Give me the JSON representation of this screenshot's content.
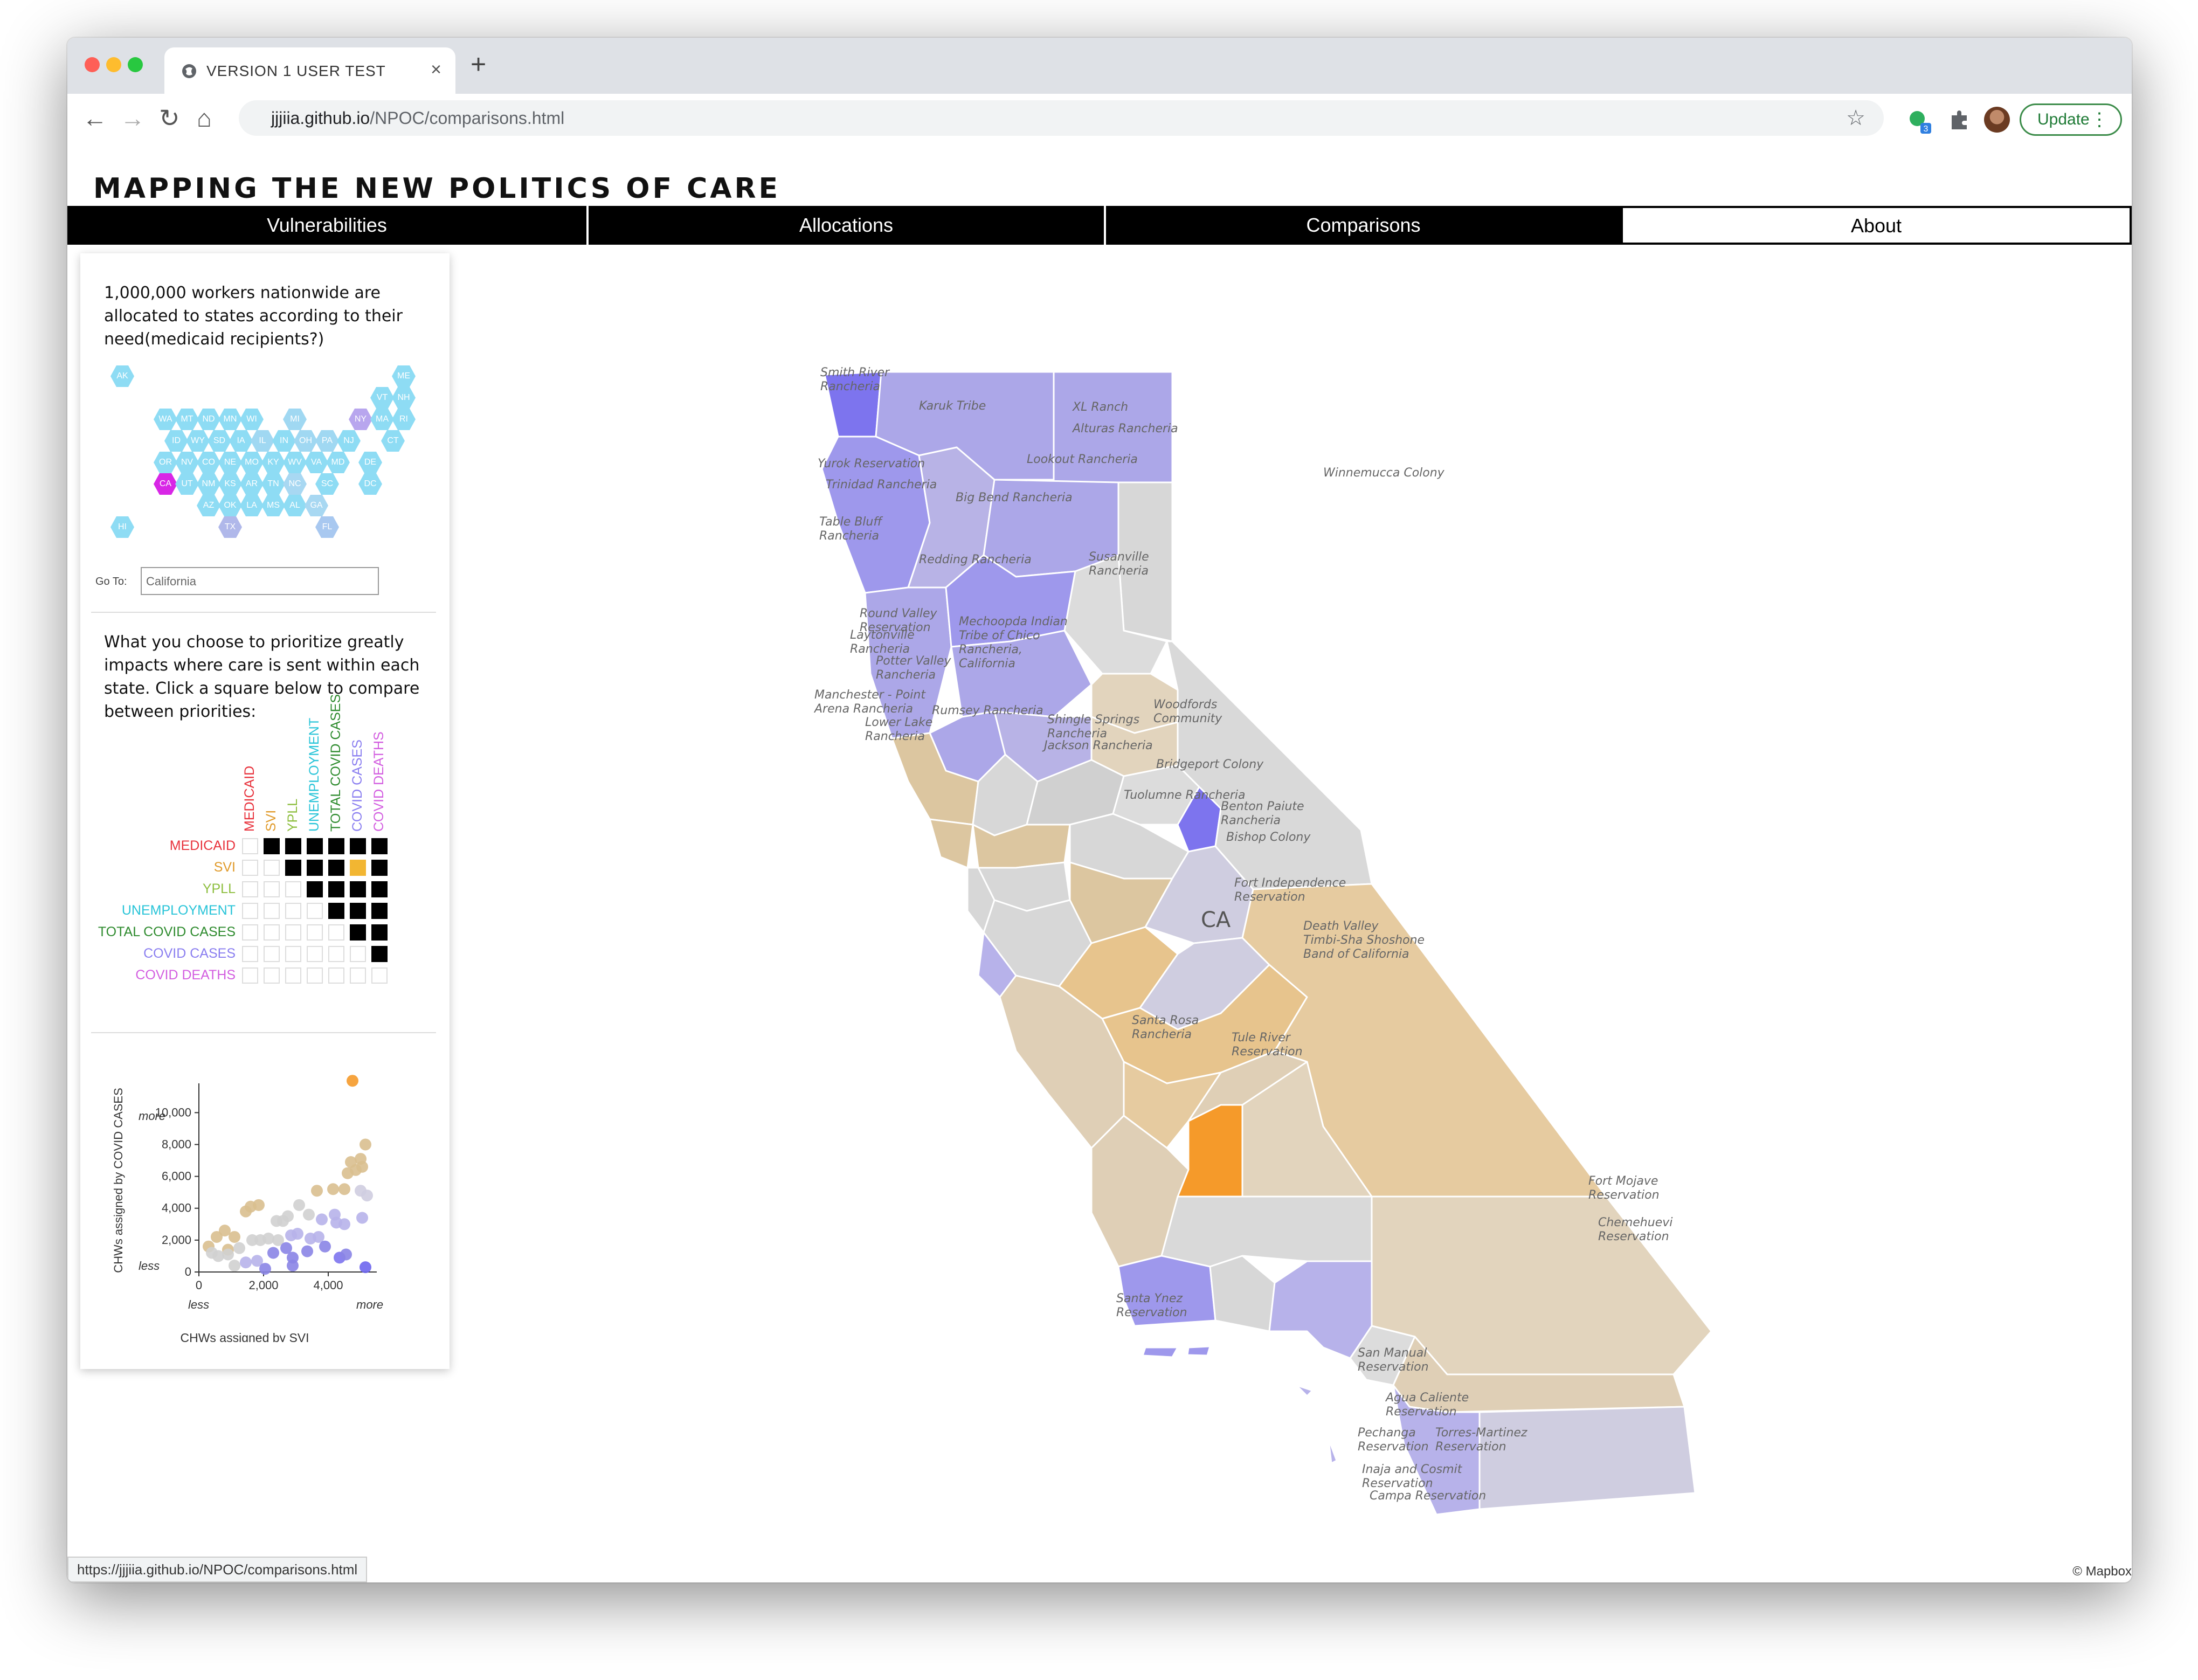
{
  "browser": {
    "tab_title": "VERSION 1 USER TEST",
    "url_host": "jjjiia.github.io",
    "url_path": "/NPOC/comparisons.html",
    "update_label": "Update",
    "extension_badge": "3",
    "status_url": "https://jjjiia.github.io/NPOC/comparisons.html"
  },
  "site": {
    "title": "MAPPING THE NEW POLITICS OF CARE",
    "nav": [
      {
        "label": "Vulnerabilities"
      },
      {
        "label": "Allocations"
      },
      {
        "label": "Comparisons"
      },
      {
        "label": "About"
      }
    ]
  },
  "panel": {
    "intro": "1,000,000 workers nationwide are allocated to states according to their need(medicaid recipients?)",
    "goto_label": "Go To:",
    "goto_value": "California",
    "priorities_text": "What you choose to prioritize greatly impacts where care is sent within each state. Click a square below to compare between priorities:",
    "states": [
      "AK",
      "ME",
      "VT",
      "NH",
      "WA",
      "MT",
      "ND",
      "MN",
      "WI",
      "MI",
      "NY",
      "MA",
      "RI",
      "ID",
      "WY",
      "SD",
      "IA",
      "IL",
      "IN",
      "OH",
      "PA",
      "NJ",
      "CT",
      "OR",
      "NV",
      "CO",
      "NE",
      "MO",
      "KY",
      "WV",
      "VA",
      "MD",
      "DE",
      "CA",
      "UT",
      "NM",
      "KS",
      "AR",
      "TN",
      "NC",
      "SC",
      "DC",
      "AZ",
      "OK",
      "LA",
      "MS",
      "AL",
      "GA",
      "HI",
      "TX",
      "FL"
    ],
    "selected_state": "CA",
    "priorities": [
      {
        "label": "MEDICAID",
        "color": "#e8323c"
      },
      {
        "label": "SVI",
        "color": "#e09a2a"
      },
      {
        "label": "YPLL",
        "color": "#8dbe3e"
      },
      {
        "label": "UNEMPLOYMENT",
        "color": "#28c4d8"
      },
      {
        "label": "TOTAL COVID CASES",
        "color": "#2e8b2e"
      },
      {
        "label": "COVID CASES",
        "color": "#8a7ef0"
      },
      {
        "label": "COVID DEATHS",
        "color": "#d35ee0"
      }
    ],
    "selected_pair": [
      "SVI",
      "COVID CASES"
    ]
  },
  "chart_data": {
    "type": "scatter",
    "xlabel": "CHWs assigned by SVI",
    "ylabel": "CHWs assigned by COVID CASES",
    "x_ticks": [
      "0",
      "2,000",
      "4,000"
    ],
    "y_ticks": [
      "0",
      "2,000",
      "4,000",
      "6,000",
      "8,000",
      "10,000"
    ],
    "x_low": "less",
    "x_high": "more",
    "y_low": "less",
    "y_high": "more",
    "xlim": [
      0,
      5500
    ],
    "ylim": [
      0,
      11500
    ],
    "points": [
      {
        "x": 4750,
        "y": 12000,
        "c": "#f59a2a"
      },
      {
        "x": 5150,
        "y": 8000,
        "c": "#d9bf8f"
      },
      {
        "x": 5000,
        "y": 7100,
        "c": "#d9bf8f"
      },
      {
        "x": 4700,
        "y": 6900,
        "c": "#d9bf8f"
      },
      {
        "x": 5050,
        "y": 6600,
        "c": "#d9bf8f"
      },
      {
        "x": 4850,
        "y": 6400,
        "c": "#d9bf8f"
      },
      {
        "x": 4600,
        "y": 6200,
        "c": "#d9bf8f"
      },
      {
        "x": 4150,
        "y": 5200,
        "c": "#d9bf8f"
      },
      {
        "x": 4500,
        "y": 5200,
        "c": "#d9bf8f"
      },
      {
        "x": 3650,
        "y": 5100,
        "c": "#d9bf8f"
      },
      {
        "x": 5000,
        "y": 5100,
        "c": "#cfcde0"
      },
      {
        "x": 5200,
        "y": 4800,
        "c": "#cfcde0"
      },
      {
        "x": 1850,
        "y": 4200,
        "c": "#d9bf8f"
      },
      {
        "x": 1600,
        "y": 4100,
        "c": "#d9bf8f"
      },
      {
        "x": 1450,
        "y": 3800,
        "c": "#d9bf8f"
      },
      {
        "x": 3100,
        "y": 4200,
        "c": "#d0d0d0"
      },
      {
        "x": 2750,
        "y": 3500,
        "c": "#d0d0d0"
      },
      {
        "x": 3400,
        "y": 3600,
        "c": "#d0d0d0"
      },
      {
        "x": 2400,
        "y": 3200,
        "c": "#d0d0d0"
      },
      {
        "x": 2600,
        "y": 3200,
        "c": "#d0d0d0"
      },
      {
        "x": 3800,
        "y": 3300,
        "c": "#b7b2ea"
      },
      {
        "x": 4250,
        "y": 3100,
        "c": "#b7b2ea"
      },
      {
        "x": 4200,
        "y": 3600,
        "c": "#b7b2ea"
      },
      {
        "x": 4500,
        "y": 3000,
        "c": "#b7b2ea"
      },
      {
        "x": 5050,
        "y": 3400,
        "c": "#b7b2ea"
      },
      {
        "x": 800,
        "y": 2600,
        "c": "#d9bf8f"
      },
      {
        "x": 1100,
        "y": 2200,
        "c": "#d9bf8f"
      },
      {
        "x": 550,
        "y": 2200,
        "c": "#d9bf8f"
      },
      {
        "x": 1900,
        "y": 2000,
        "c": "#d0d0d0"
      },
      {
        "x": 2150,
        "y": 2100,
        "c": "#d0d0d0"
      },
      {
        "x": 2450,
        "y": 2000,
        "c": "#d0d0d0"
      },
      {
        "x": 1650,
        "y": 2000,
        "c": "#d0d0d0"
      },
      {
        "x": 3050,
        "y": 2400,
        "c": "#b7b2ea"
      },
      {
        "x": 3450,
        "y": 2100,
        "c": "#b7b2ea"
      },
      {
        "x": 3700,
        "y": 2200,
        "c": "#b7b2ea"
      },
      {
        "x": 2850,
        "y": 2300,
        "c": "#b7b2ea"
      },
      {
        "x": 300,
        "y": 1600,
        "c": "#d9bf8f"
      },
      {
        "x": 900,
        "y": 1400,
        "c": "#d9bf8f"
      },
      {
        "x": 600,
        "y": 1000,
        "c": "#d0d0d0"
      },
      {
        "x": 400,
        "y": 1200,
        "c": "#d0d0d0"
      },
      {
        "x": 1250,
        "y": 1500,
        "c": "#d0d0d0"
      },
      {
        "x": 900,
        "y": 1100,
        "c": "#d0d0d0"
      },
      {
        "x": 2300,
        "y": 1200,
        "c": "#8a84e6"
      },
      {
        "x": 2700,
        "y": 1500,
        "c": "#8a84e6"
      },
      {
        "x": 2900,
        "y": 900,
        "c": "#8a84e6"
      },
      {
        "x": 3350,
        "y": 1300,
        "c": "#8a84e6"
      },
      {
        "x": 3900,
        "y": 1600,
        "c": "#8a84e6"
      },
      {
        "x": 4350,
        "y": 900,
        "c": "#7d74ee"
      },
      {
        "x": 4550,
        "y": 1100,
        "c": "#8a84e6"
      },
      {
        "x": 1450,
        "y": 600,
        "c": "#b7b2ea"
      },
      {
        "x": 1800,
        "y": 700,
        "c": "#b7b2ea"
      },
      {
        "x": 1100,
        "y": 400,
        "c": "#d0d0d0"
      },
      {
        "x": 2050,
        "y": 200,
        "c": "#8a84e6"
      },
      {
        "x": 2900,
        "y": 400,
        "c": "#8a84e6"
      },
      {
        "x": 5150,
        "y": 300,
        "c": "#6e66ee"
      }
    ]
  },
  "map": {
    "state_label": "CA",
    "places": [
      "Smith River Rancheria",
      "Karuk Tribe",
      "XL Ranch",
      "Alturas Rancheria",
      "Yurok Reservation",
      "Lookout Rancheria",
      "Trinidad Rancheria",
      "Big Bend Rancheria",
      "Table Bluff Rancheria",
      "Winnemucca Colony",
      "Redding Rancheria",
      "Susanville Rancheria",
      "Round Valley Reservation",
      "Mechoopda Indian Tribe of Chico Rancheria, California",
      "Laytonville Rancheria",
      "Potter Valley Rancheria",
      "Manchester - Point Arena Rancheria",
      "Rumsey Rancheria",
      "Woodfords Community",
      "Lower Lake Rancheria",
      "Shingle Springs Rancheria",
      "Jackson Rancheria",
      "Bridgeport Colony",
      "Tuolumne Rancheria",
      "Benton Paiute Rancheria",
      "Bishop Colony",
      "Fort Independence Reservation",
      "Death Valley Timbi-Sha Shoshone Band of California",
      "Santa Rosa Rancheria",
      "Tule River Reservation",
      "Fort Mojave Reservation",
      "Chemehuevi Reservation",
      "Santa Ynez Reservation",
      "San Manual Reservation",
      "Agua Caliente Reservation",
      "Pechanga Reservation",
      "Torres-Martinez Reservation",
      "Inaja and Cosmit Reservation",
      "Campa Reservation"
    ],
    "attribution": "© Mapbox"
  }
}
